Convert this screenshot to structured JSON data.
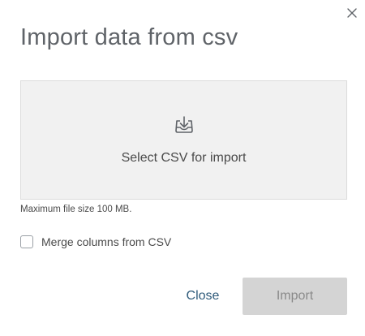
{
  "dialog": {
    "title": "Import data from csv",
    "close_icon": "close-icon"
  },
  "dropzone": {
    "icon": "download-tray-icon",
    "label": "Select CSV for import"
  },
  "hint": "Maximum file size 100 MB.",
  "options": {
    "merge_label": "Merge columns from CSV",
    "merge_checked": false
  },
  "actions": {
    "close_label": "Close",
    "import_label": "Import",
    "import_enabled": false
  },
  "colors": {
    "close_text": "#2e5a7a",
    "import_disabled_bg": "#d4d4d4",
    "dropzone_bg": "#f1f1f1"
  }
}
